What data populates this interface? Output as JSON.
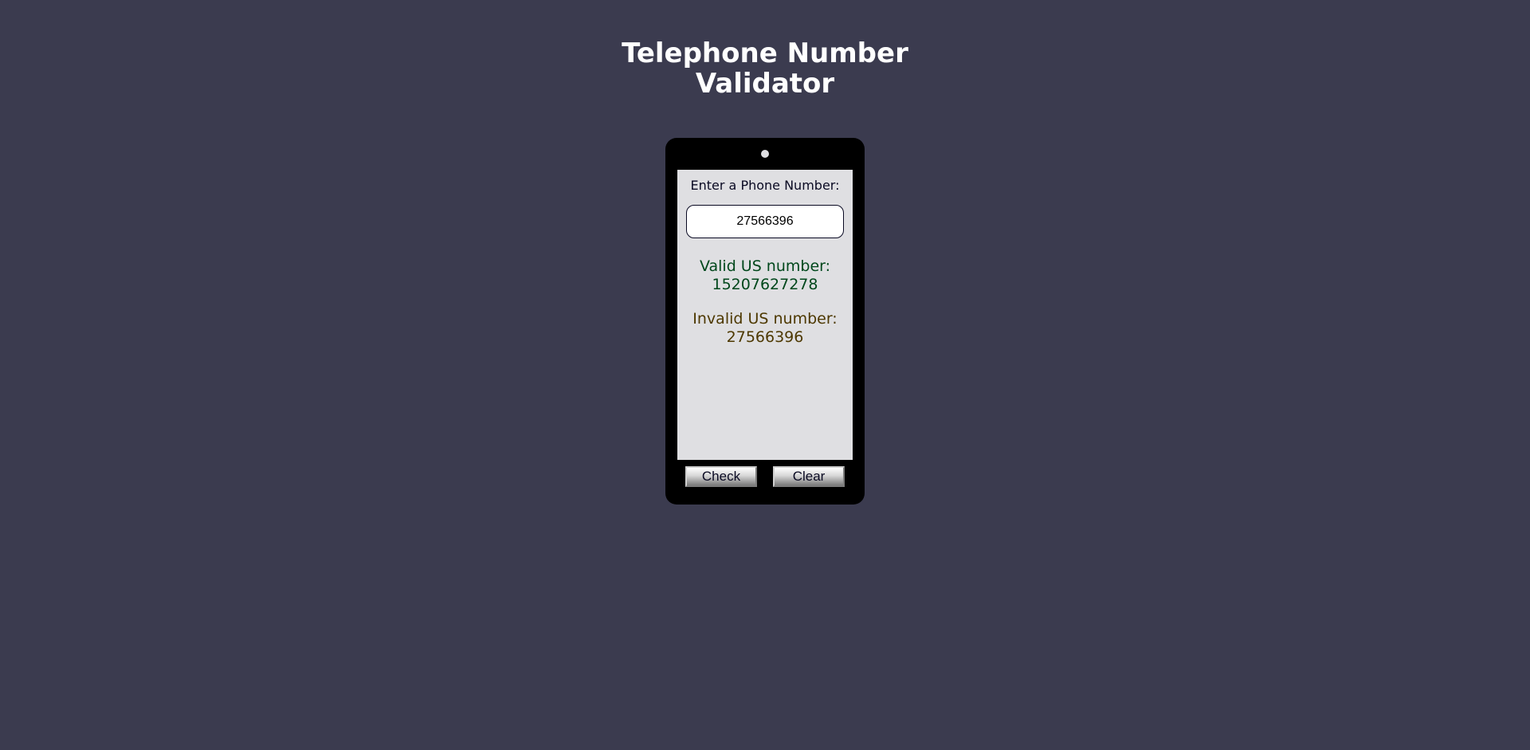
{
  "header": {
    "title_line1": "Telephone Number",
    "title_line2": "Validator"
  },
  "form": {
    "label": "Enter a Phone Number:",
    "input_value": "27566396"
  },
  "results": [
    {
      "status": "valid",
      "label": "Valid US number:",
      "number": "15207627278"
    },
    {
      "status": "invalid",
      "label": "Invalid US number:",
      "number": "27566396"
    }
  ],
  "buttons": {
    "check_label": "Check",
    "clear_label": "Clear"
  },
  "colors": {
    "background": "#3b3b4f",
    "phone_body": "#000000",
    "screen": "#dfdfe2",
    "valid_text": "#00471b",
    "invalid_text": "#4d3800"
  }
}
